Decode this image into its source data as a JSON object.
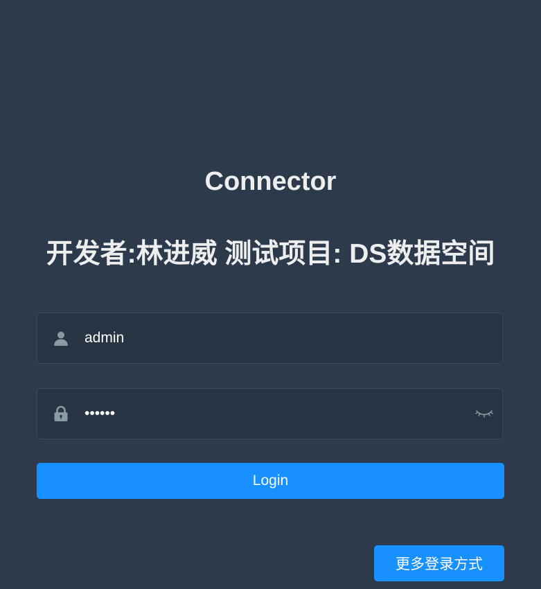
{
  "header": {
    "title": "Connector",
    "subtitle": "开发者:林进威 测试项目: DS数据空间"
  },
  "form": {
    "username": {
      "value": "admin",
      "icon": "user-icon"
    },
    "password": {
      "value": "••••••",
      "icon": "lock-icon",
      "toggle_icon": "eye-closed-icon"
    },
    "login_label": "Login"
  },
  "footer": {
    "more_login_label": "更多登录方式"
  },
  "colors": {
    "background": "#2d3a4b",
    "input_background": "#283443",
    "primary": "#1890ff",
    "icon": "#889aa4"
  }
}
